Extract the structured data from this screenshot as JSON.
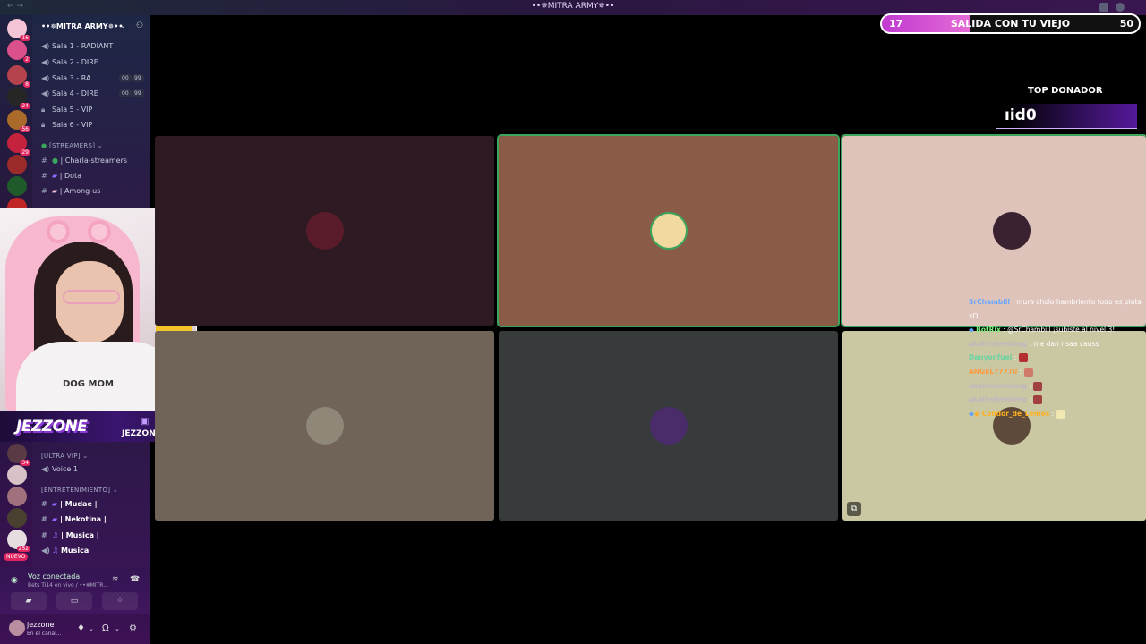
{
  "window": {
    "title": "••✵MITRA ARMY✵••",
    "nav": "← →"
  },
  "goal": {
    "current": "17",
    "label": "SALIDA CON TU VIEJO",
    "target": "50",
    "progress_fraction": 0.34
  },
  "top_donor": {
    "title": "TOP DONADOR",
    "name": "ıid0"
  },
  "guild_badges": [
    "16",
    "2",
    "8",
    "24",
    "56",
    "29"
  ],
  "guild_badges2": [
    "34",
    "252"
  ],
  "guild_new_label": "NUEVO",
  "server": {
    "name": "••✵MITRA ARMY✵••"
  },
  "voice_channels": [
    {
      "label": "Sala 1 - RADIANT",
      "icon": "speaker-icon"
    },
    {
      "label": "Sala 2 - DIRE",
      "icon": "speaker-icon"
    },
    {
      "label": "Sala 3 - RA...",
      "icon": "speaker-icon",
      "count_a": "00",
      "count_b": "99"
    },
    {
      "label": "Sala 4 - DIRE",
      "icon": "speaker-icon",
      "count_a": "00",
      "count_b": "99"
    },
    {
      "label": "Sala 5 - VIP",
      "icon": "lock-icon"
    },
    {
      "label": "Sala 6 - VIP",
      "icon": "lock-icon"
    }
  ],
  "streamers_category": "[STREAMERS]",
  "streamer_channels": [
    "| Charla-streamers",
    "| Dota",
    "| Among-us"
  ],
  "ultra_vip_category": "[ULTRA VIP]",
  "ultra_vip_channels": [
    "Voice 1"
  ],
  "entretenimiento_category": "[ENTRETENIMIENTO]",
  "entretenimiento_channels": [
    "| Mudae |",
    "| Nekotina |",
    "| Musica |",
    "Musica"
  ],
  "voice_panel": {
    "title": "Voz conectada",
    "subtitle": "Bets Ti14 en vivo / ••✵MITR..."
  },
  "user": {
    "name": "jezzone",
    "status": "En el canal..."
  },
  "webcam": {
    "shirt_text": "DOG MOM"
  },
  "brand": {
    "logo": "JEZZONE",
    "handle": "JEZZONE_"
  },
  "tiles": [
    {
      "color": "#2e1a23",
      "avatar": "#5a1c2a"
    },
    {
      "color": "#8a5c48",
      "avatar": "#f1d9a0"
    },
    {
      "color": "#dec3bb",
      "avatar": "#3a2230"
    },
    {
      "color": "#706458",
      "avatar": "#8f8777"
    },
    {
      "color": "#383b3c",
      "avatar": "#4a2c6a"
    },
    {
      "color": "#c9c8a2",
      "avatar": "#5d4a3a"
    }
  ],
  "chat": [
    {
      "user": "SrChambill",
      "user_color": "#6aa6ff",
      "text": ": mura cholo hambriento todo es plata xD"
    },
    {
      "user": "BotRix",
      "user_color": "#7bf27b",
      "text": ": @SrChambill ¡subiste al nivel 3!"
    },
    {
      "user": "akalheisenberg",
      "user_color": "#c3b5c2",
      "text": ": me dan risaa causs"
    },
    {
      "user": "Danyonfuel",
      "user_color": "#6cd3a5",
      "text": ":"
    },
    {
      "user": "ANGEL77770",
      "user_color": "#ff9a3c",
      "text": ":"
    },
    {
      "user": "akalheisenberg",
      "user_color": "#c3b5c2",
      "text": ":"
    },
    {
      "user": "akalheisenberg",
      "user_color": "#c3b5c2",
      "text": ":"
    },
    {
      "user": "Condor_de_Lemos",
      "user_color": "#ffb020",
      "text": ":"
    }
  ]
}
